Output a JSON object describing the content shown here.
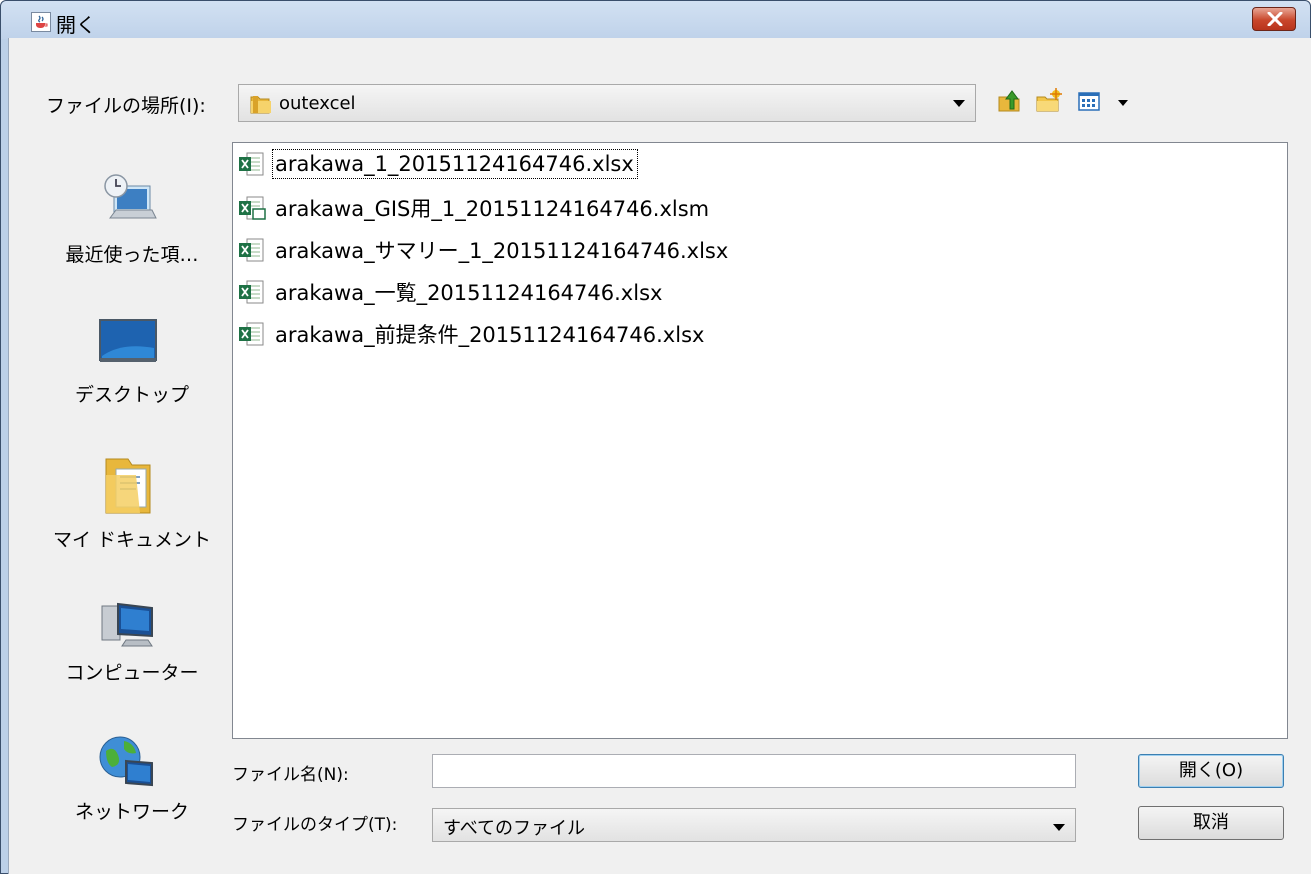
{
  "window": {
    "title": "開く",
    "title_icon": "java-cup-icon",
    "close_icon": "close-icon"
  },
  "look_in": {
    "label": "ファイルの場所(I):",
    "value": "outexcel",
    "folder_icon": "folder-icon"
  },
  "toolbar": {
    "up_icon": "up-folder-icon",
    "new_folder_icon": "new-folder-icon",
    "view_menu_icon": "view-menu-icon"
  },
  "places": [
    {
      "label": "最近使った項…",
      "icon": "recent-items-icon"
    },
    {
      "label": "デスクトップ",
      "icon": "desktop-icon"
    },
    {
      "label": "マイ ドキュメント",
      "icon": "my-documents-icon"
    },
    {
      "label": "コンピューター",
      "icon": "computer-icon"
    },
    {
      "label": "ネットワーク",
      "icon": "network-icon"
    }
  ],
  "files": [
    {
      "name": "arakawa_1_20151124164746.xlsx",
      "icon": "excel-file-icon",
      "focused": true
    },
    {
      "name": "arakawa_GIS用_1_20151124164746.xlsm",
      "icon": "excel-macro-file-icon",
      "focused": false
    },
    {
      "name": "arakawa_サマリー_1_20151124164746.xlsx",
      "icon": "excel-file-icon",
      "focused": false
    },
    {
      "name": "arakawa_一覧_20151124164746.xlsx",
      "icon": "excel-file-icon",
      "focused": false
    },
    {
      "name": "arakawa_前提条件_20151124164746.xlsx",
      "icon": "excel-file-icon",
      "focused": false
    }
  ],
  "file_name": {
    "label": "ファイル名(N):",
    "value": ""
  },
  "file_type": {
    "label": "ファイルのタイプ(T):",
    "value": "すべてのファイル"
  },
  "buttons": {
    "open": "開く(O)",
    "cancel": "取消"
  },
  "colors": {
    "frame": "#bcd0e8",
    "close_button": "#c9472c",
    "client_bg": "#f0f0f0",
    "excel_green": "#1e7145"
  }
}
